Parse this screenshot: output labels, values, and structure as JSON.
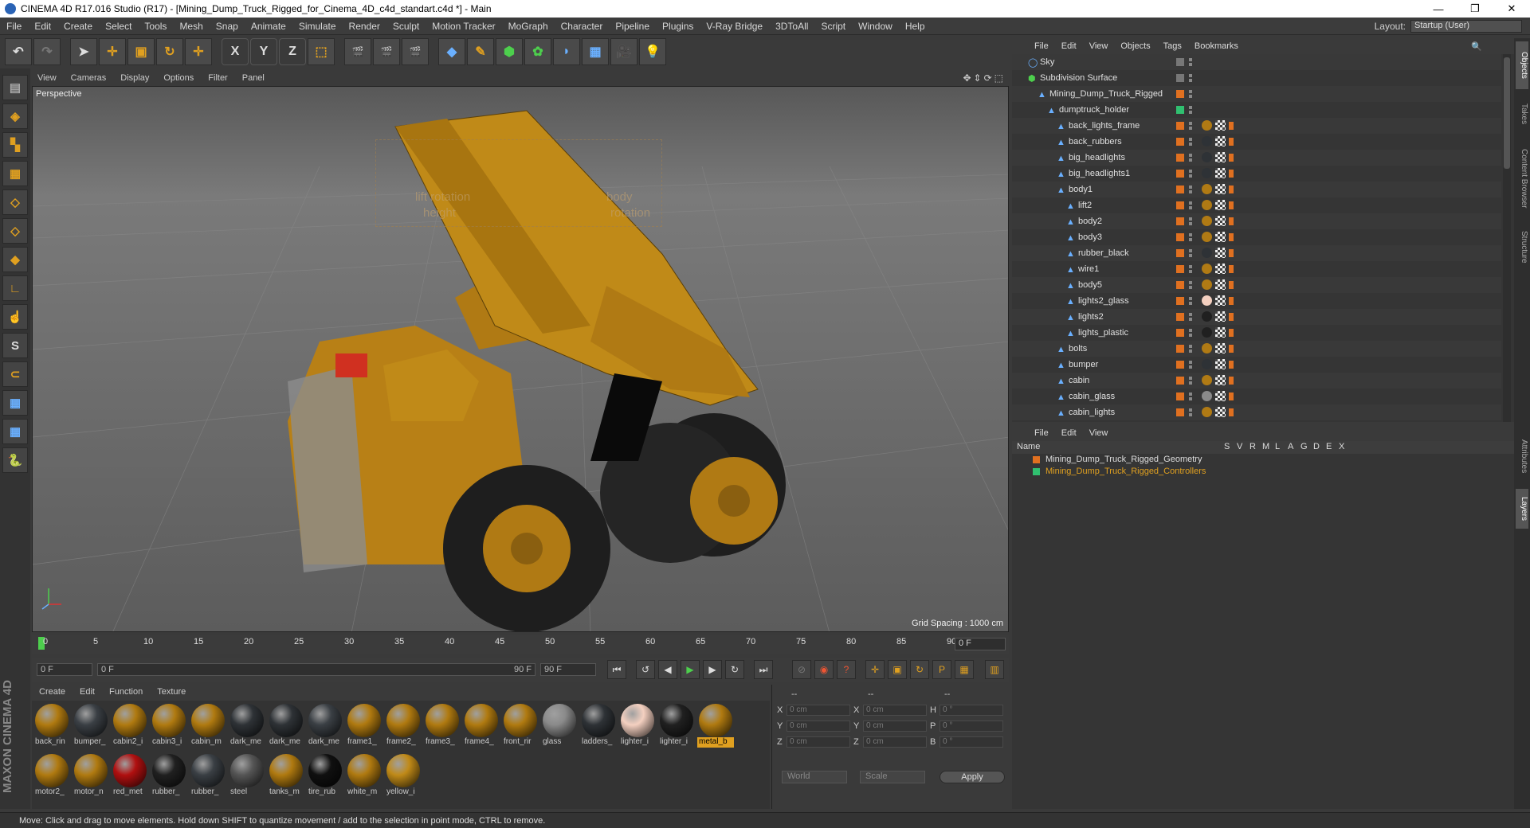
{
  "window": {
    "title": "CINEMA 4D R17.016 Studio (R17) - [Mining_Dump_Truck_Rigged_for_Cinema_4D_c4d_standart.c4d *] - Main",
    "min": "—",
    "max": "❐",
    "close": "✕"
  },
  "menu": [
    "File",
    "Edit",
    "Create",
    "Select",
    "Tools",
    "Mesh",
    "Snap",
    "Animate",
    "Simulate",
    "Render",
    "Sculpt",
    "Motion Tracker",
    "MoGraph",
    "Character",
    "Pipeline",
    "Plugins",
    "V-Ray Bridge",
    "3DToAll",
    "Script",
    "Window",
    "Help"
  ],
  "layout": {
    "label": "Layout:",
    "value": "Startup (User)"
  },
  "toolbar": {
    "x": "X",
    "y": "Y",
    "z": "Z"
  },
  "viewport": {
    "menu": [
      "View",
      "Cameras",
      "Display",
      "Options",
      "Filter",
      "Panel"
    ],
    "label": "Perspective",
    "grid_spacing": "Grid Spacing : 1000 cm",
    "overlay_text_1": "lift rotation",
    "overlay_text_2": "height",
    "overlay_text_3": "body",
    "overlay_text_4": "rotation"
  },
  "timeline": {
    "ticks": [
      "0",
      "5",
      "10",
      "15",
      "20",
      "25",
      "30",
      "35",
      "40",
      "45",
      "50",
      "55",
      "60",
      "65",
      "70",
      "75",
      "80",
      "85",
      "90"
    ],
    "current_frame": "0 F",
    "start": "0 F",
    "range_start": "0 F",
    "range_end": "90 F",
    "end": "90 F"
  },
  "materials": {
    "menu": [
      "Create",
      "Edit",
      "Function",
      "Texture"
    ],
    "items": [
      {
        "name": "back_rin",
        "color": "#b07a10"
      },
      {
        "name": "bumper_",
        "color": "#3a3f44"
      },
      {
        "name": "cabin2_i",
        "color": "#b07a10"
      },
      {
        "name": "cabin3_i",
        "color": "#b07a10"
      },
      {
        "name": "cabin_m",
        "color": "#b07a10"
      },
      {
        "name": "dark_me",
        "color": "#2e3236"
      },
      {
        "name": "dark_me",
        "color": "#2e3236"
      },
      {
        "name": "dark_me",
        "color": "#3a3f44"
      },
      {
        "name": "frame1_",
        "color": "#b07a10"
      },
      {
        "name": "frame2_",
        "color": "#b07a10"
      },
      {
        "name": "frame3_",
        "color": "#b07a10"
      },
      {
        "name": "frame4_",
        "color": "#b07a10"
      },
      {
        "name": "front_rir",
        "color": "#b07a10"
      },
      {
        "name": "glass",
        "color": "#8a8a8a"
      },
      {
        "name": "ladders_",
        "color": "#2e3236"
      },
      {
        "name": "lighter_i",
        "color": "#f4d0c0"
      },
      {
        "name": "lighter_i",
        "color": "#202020"
      },
      {
        "name": "metal_b",
        "color": "#b07a10",
        "selected": true
      },
      {
        "name": "motor2_",
        "color": "#b07a10"
      },
      {
        "name": "motor_n",
        "color": "#b07a10"
      },
      {
        "name": "red_met",
        "color": "#b01010"
      },
      {
        "name": "rubber_",
        "color": "#202020"
      },
      {
        "name": "rubber_",
        "color": "#3a3f44"
      },
      {
        "name": "steel",
        "color": "#555555"
      },
      {
        "name": "tanks_m",
        "color": "#b07a10"
      },
      {
        "name": "tire_rub",
        "color": "#101010"
      },
      {
        "name": "white_m",
        "color": "#b07a10"
      },
      {
        "name": "yellow_i",
        "color": "#c08a18"
      }
    ]
  },
  "coords": {
    "header_left": "--",
    "header_mid": "--",
    "header_right": "--",
    "rows": [
      {
        "a": "X",
        "av": "0 cm",
        "b": "X",
        "bv": "0 cm",
        "c": "H",
        "cv": "0 °"
      },
      {
        "a": "Y",
        "av": "0 cm",
        "b": "Y",
        "bv": "0 cm",
        "c": "P",
        "cv": "0 °"
      },
      {
        "a": "Z",
        "av": "0 cm",
        "b": "Z",
        "bv": "0 cm",
        "c": "B",
        "cv": "0 °"
      }
    ],
    "world": "World",
    "scale": "Scale",
    "apply": "Apply"
  },
  "objects": {
    "menu": [
      "File",
      "Edit",
      "View",
      "Objects",
      "Tags",
      "Bookmarks"
    ],
    "rows": [
      {
        "name": "Sky",
        "indent": 0
      },
      {
        "name": "Subdivision Surface",
        "indent": 0
      },
      {
        "name": "Mining_Dump_Truck_Rigged",
        "indent": 1
      },
      {
        "name": "dumptruck_holder",
        "indent": 2
      },
      {
        "name": "back_lights_frame",
        "indent": 3
      },
      {
        "name": "back_rubbers",
        "indent": 3
      },
      {
        "name": "big_headlights",
        "indent": 3
      },
      {
        "name": "big_headlights1",
        "indent": 3
      },
      {
        "name": "body1",
        "indent": 3
      },
      {
        "name": "lift2",
        "indent": 4
      },
      {
        "name": "body2",
        "indent": 4
      },
      {
        "name": "body3",
        "indent": 4
      },
      {
        "name": "rubber_black",
        "indent": 4
      },
      {
        "name": "wire1",
        "indent": 4
      },
      {
        "name": "body5",
        "indent": 4
      },
      {
        "name": "lights2_glass",
        "indent": 4
      },
      {
        "name": "lights2",
        "indent": 4
      },
      {
        "name": "lights_plastic",
        "indent": 4
      },
      {
        "name": "bolts",
        "indent": 3
      },
      {
        "name": "bumper",
        "indent": 3
      },
      {
        "name": "cabin",
        "indent": 3
      },
      {
        "name": "cabin_glass",
        "indent": 3
      },
      {
        "name": "cabin_lights",
        "indent": 3
      }
    ]
  },
  "layers": {
    "menu": [
      "File",
      "Edit",
      "View"
    ],
    "header": {
      "name": "Name",
      "cols": [
        "S",
        "V",
        "R",
        "M",
        "L",
        "A",
        "G",
        "D",
        "E",
        "X"
      ]
    },
    "rows": [
      {
        "name": "Mining_Dump_Truck_Rigged_Geometry",
        "color": "#e07020",
        "text_color": "#dddddd"
      },
      {
        "name": "Mining_Dump_Truck_Rigged_Controllers",
        "color": "#30c070",
        "text_color": "#e0a020"
      }
    ]
  },
  "right_tabs": [
    "Objects",
    "Takes",
    "Content Browser",
    "Structure",
    "Attributes",
    "Layers"
  ],
  "status": "Move: Click and drag to move elements. Hold down SHIFT to quantize movement / add to the selection in point mode, CTRL to remove.",
  "brand": "MAXON CINEMA 4D"
}
